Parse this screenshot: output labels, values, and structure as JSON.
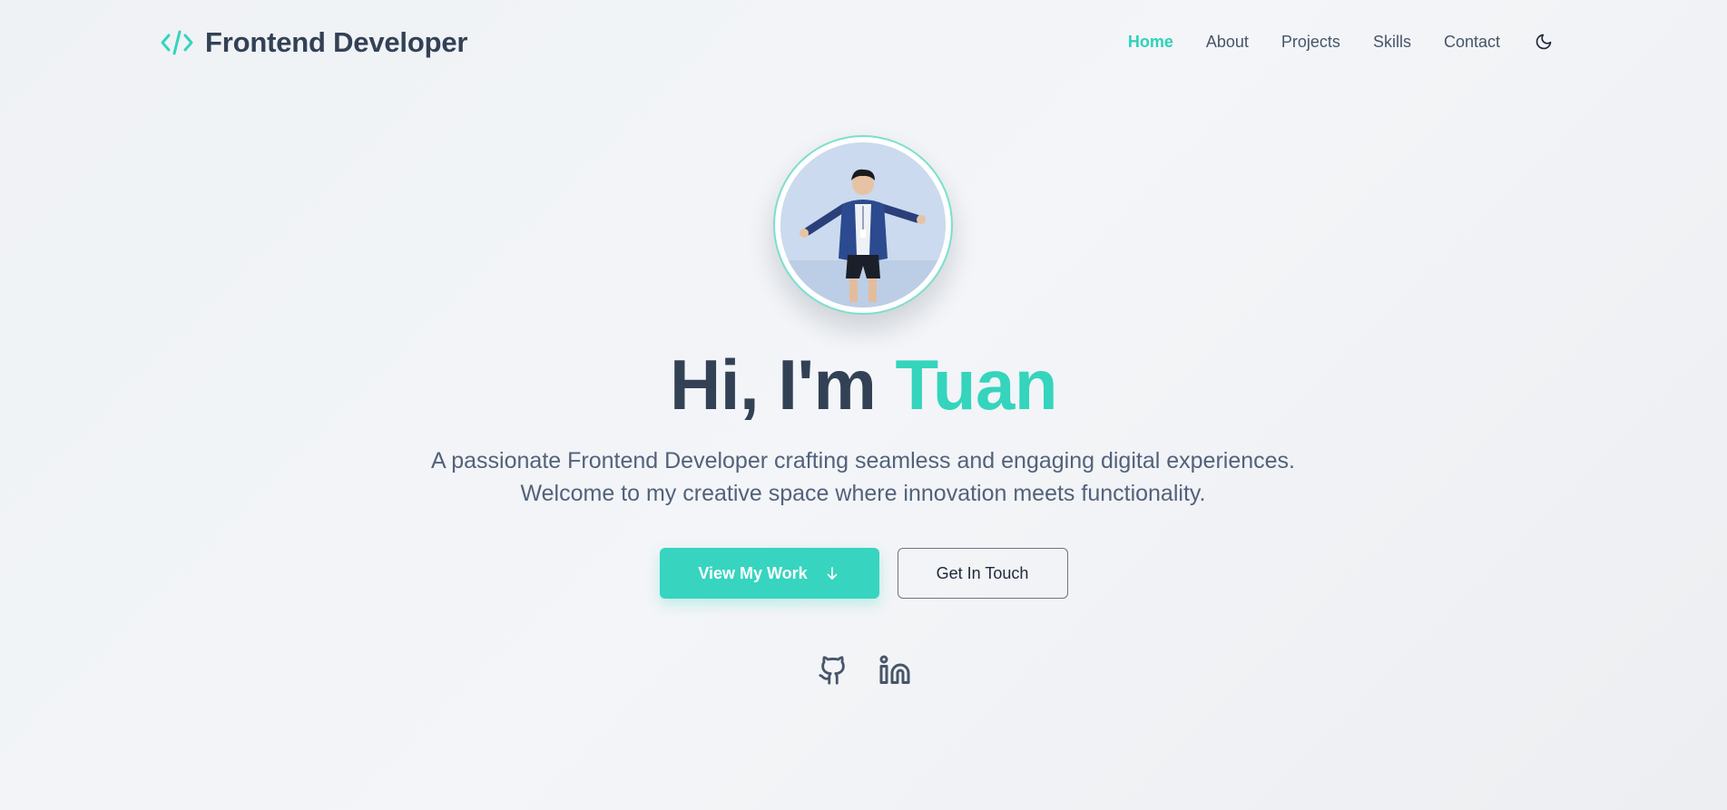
{
  "header": {
    "brand": {
      "icon": "code-icon",
      "name": "Frontend Developer"
    },
    "nav": {
      "items": [
        {
          "label": "Home",
          "active": true
        },
        {
          "label": "About",
          "active": false
        },
        {
          "label": "Projects",
          "active": false
        },
        {
          "label": "Skills",
          "active": false
        },
        {
          "label": "Contact",
          "active": false
        }
      ],
      "theme_toggle_icon": "moon-icon"
    }
  },
  "hero": {
    "avatar_icon": "profile-photo",
    "title_prefix": "Hi, I'm ",
    "title_name": "Tuan",
    "description": "A passionate Frontend Developer crafting seamless and engaging digital experiences. Welcome to my creative space where innovation meets functionality.",
    "primary_button": {
      "label": "View My Work",
      "icon": "arrow-down-icon"
    },
    "secondary_button": {
      "label": "Get In Touch"
    },
    "social": [
      {
        "name": "GitHub",
        "icon": "github-icon"
      },
      {
        "name": "LinkedIn",
        "icon": "linkedin-icon"
      }
    ]
  },
  "colors": {
    "accent": "#35d4bd",
    "text_dark": "#334155",
    "text_muted": "#53627a",
    "background": "#f1f4f7"
  }
}
